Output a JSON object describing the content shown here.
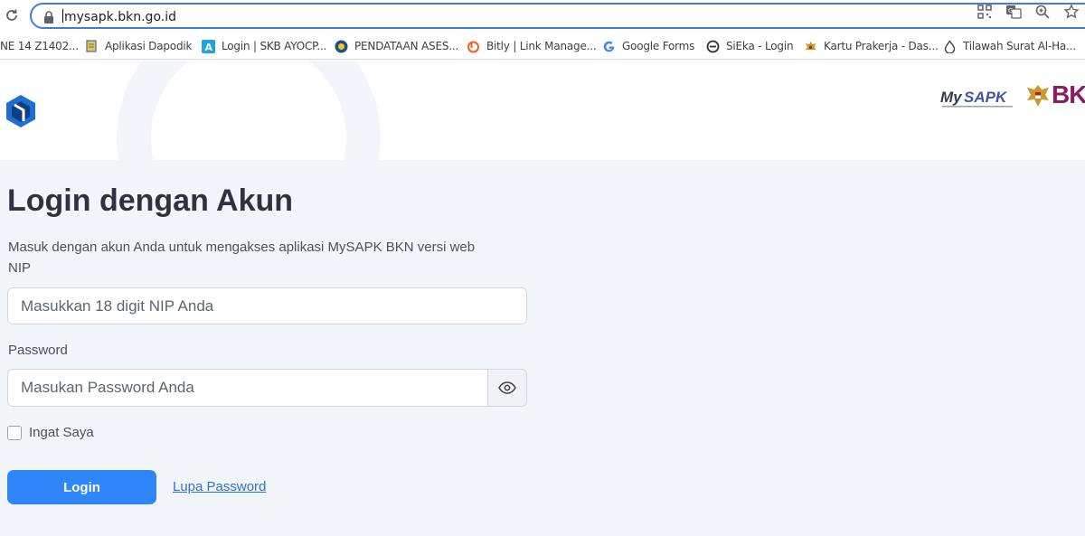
{
  "browser": {
    "url": "mysapk.bkn.go.id",
    "bookmarks": [
      {
        "label": "NE 14 Z1402...",
        "icon": "none"
      },
      {
        "label": "Aplikasi Dapodik",
        "icon": "document-icon"
      },
      {
        "label": "Login | SKB AYOCP...",
        "icon": "a-letter-icon"
      },
      {
        "label": "PENDATAAN ASES...",
        "icon": "globe-emblem-icon"
      },
      {
        "label": "Bitly | Link Manage...",
        "icon": "bitly-icon"
      },
      {
        "label": "Google Forms",
        "icon": "google-icon"
      },
      {
        "label": "SiEka - Login",
        "icon": "e-logo-icon"
      },
      {
        "label": "Kartu Prakerja - Das...",
        "icon": "garuda-icon"
      },
      {
        "label": "Tilawah Surat Al-Ha...",
        "icon": "drop-icon"
      }
    ]
  },
  "header": {
    "brand_logo": "mysapk-logo",
    "agency_logo": "BK"
  },
  "login": {
    "title": "Login dengan Akun",
    "subtitle": "Masuk dengan akun Anda untuk mengakses aplikasi MySAPK BKN versi web",
    "nip_label": "NIP",
    "nip_placeholder": "Masukkan 18 digit NIP Anda",
    "password_label": "Password",
    "password_placeholder": "Masukan Password Anda",
    "remember_label": "Ingat Saya",
    "login_button": "Login",
    "forgot_link": "Lupa Password"
  },
  "colors": {
    "accent": "#2f86fb",
    "background": "#f2f5fa",
    "bkn_brand": "#8a1c66"
  }
}
